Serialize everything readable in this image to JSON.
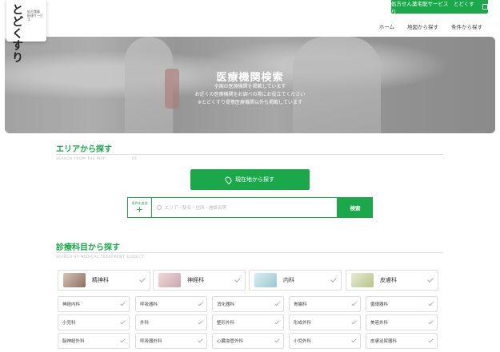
{
  "logo": {
    "main": "とどくすり",
    "sub": "処方箋薬 配達サービス"
  },
  "header": {
    "cta_label": "処方せん薬宅配サービス　とどくすり",
    "nav": [
      "ホーム",
      "地図から探す",
      "条件から探す"
    ]
  },
  "hero": {
    "title": "医療機関検索",
    "lines": [
      "全国の医療機関を掲載しています",
      "お近くの医療機関をお調べの際にお役立てください",
      "※とどくすり提携医療機関以外も掲載しています"
    ]
  },
  "area": {
    "title": "エリアから探す",
    "sub": "SEARCH FROM THE MAP",
    "sub2": "OT",
    "locate_label": "現在地から探す",
    "cond_label": "条件を追加",
    "cond_plus": "+",
    "search_placeholder": "エリア・駅名・住所・施設名等",
    "search_button": "検索"
  },
  "dept": {
    "title": "診療科目から探す",
    "sub": "SEARCH BY MEDICAL TREATMENT SUBJECT",
    "featured": [
      "精神科",
      "神経科",
      "内科",
      "皮膚科"
    ],
    "rows": [
      [
        "神経内科",
        "呼吸器科",
        "消化器科",
        "胃腸科",
        "循環器科"
      ],
      [
        "小児科",
        "外科",
        "整形外科",
        "形成外科",
        "美容外科"
      ],
      [
        "脳神経外科",
        "呼吸器外科",
        "心臓血管外科",
        "小児外科",
        "皮膚泌尿器科"
      ]
    ]
  },
  "colors": {
    "accent": "#1aa84a"
  }
}
